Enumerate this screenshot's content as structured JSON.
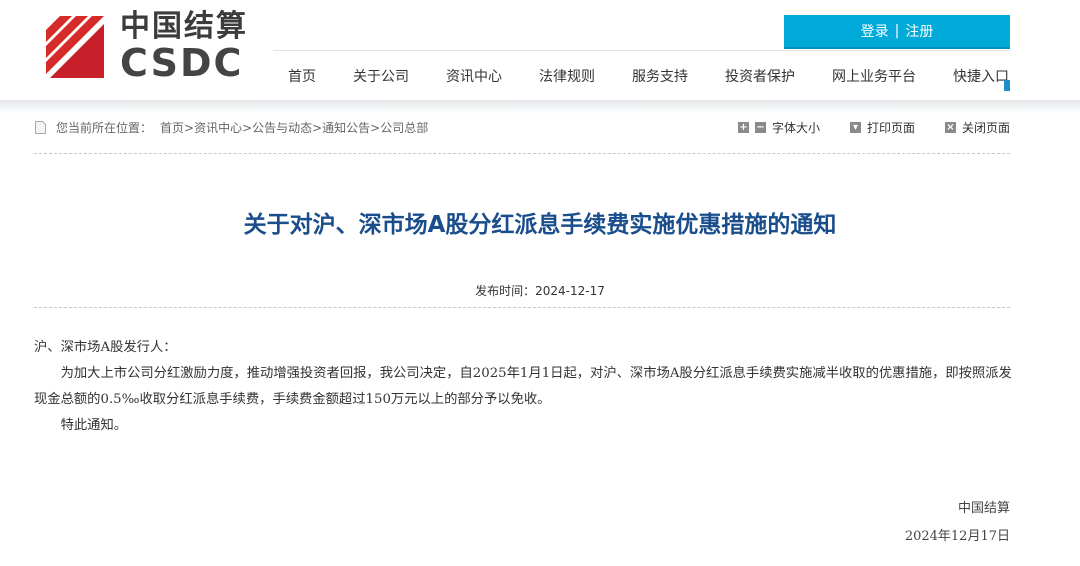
{
  "logo": {
    "cn": "中国结算",
    "en": "CSDC"
  },
  "header": {
    "login": "登录",
    "sep": "|",
    "register": "注册"
  },
  "nav": [
    "首页",
    "关于公司",
    "资讯中心",
    "法律规则",
    "服务支持",
    "投资者保护",
    "网上业务平台",
    "快捷入口"
  ],
  "breadcrumb": {
    "label": "您当前所在位置：",
    "path": "首页>资讯中心>公告与动态>通知公告>公司总部"
  },
  "tools": {
    "font_size": "字体大小",
    "print": "打印页面",
    "close": "关闭页面"
  },
  "article": {
    "title": "关于对沪、深市场A股分红派息手续费实施优惠措施的通知",
    "date_label": "发布时间：",
    "date": "2024-12-17",
    "salutation": "沪、深市场A股发行人：",
    "paragraph": "为加大上市公司分红激励力度，推动增强投资者回报，我公司决定，自2025年1月1日起，对沪、深市场A股分红派息手续费实施减半收取的优惠措施，即按照派发现金总额的0.5‰收取分红派息手续费，手续费金额超过150万元以上的部分予以免收。",
    "closing": "特此通知。",
    "signature": "中国结算",
    "sign_date": "2024年12月17日"
  }
}
